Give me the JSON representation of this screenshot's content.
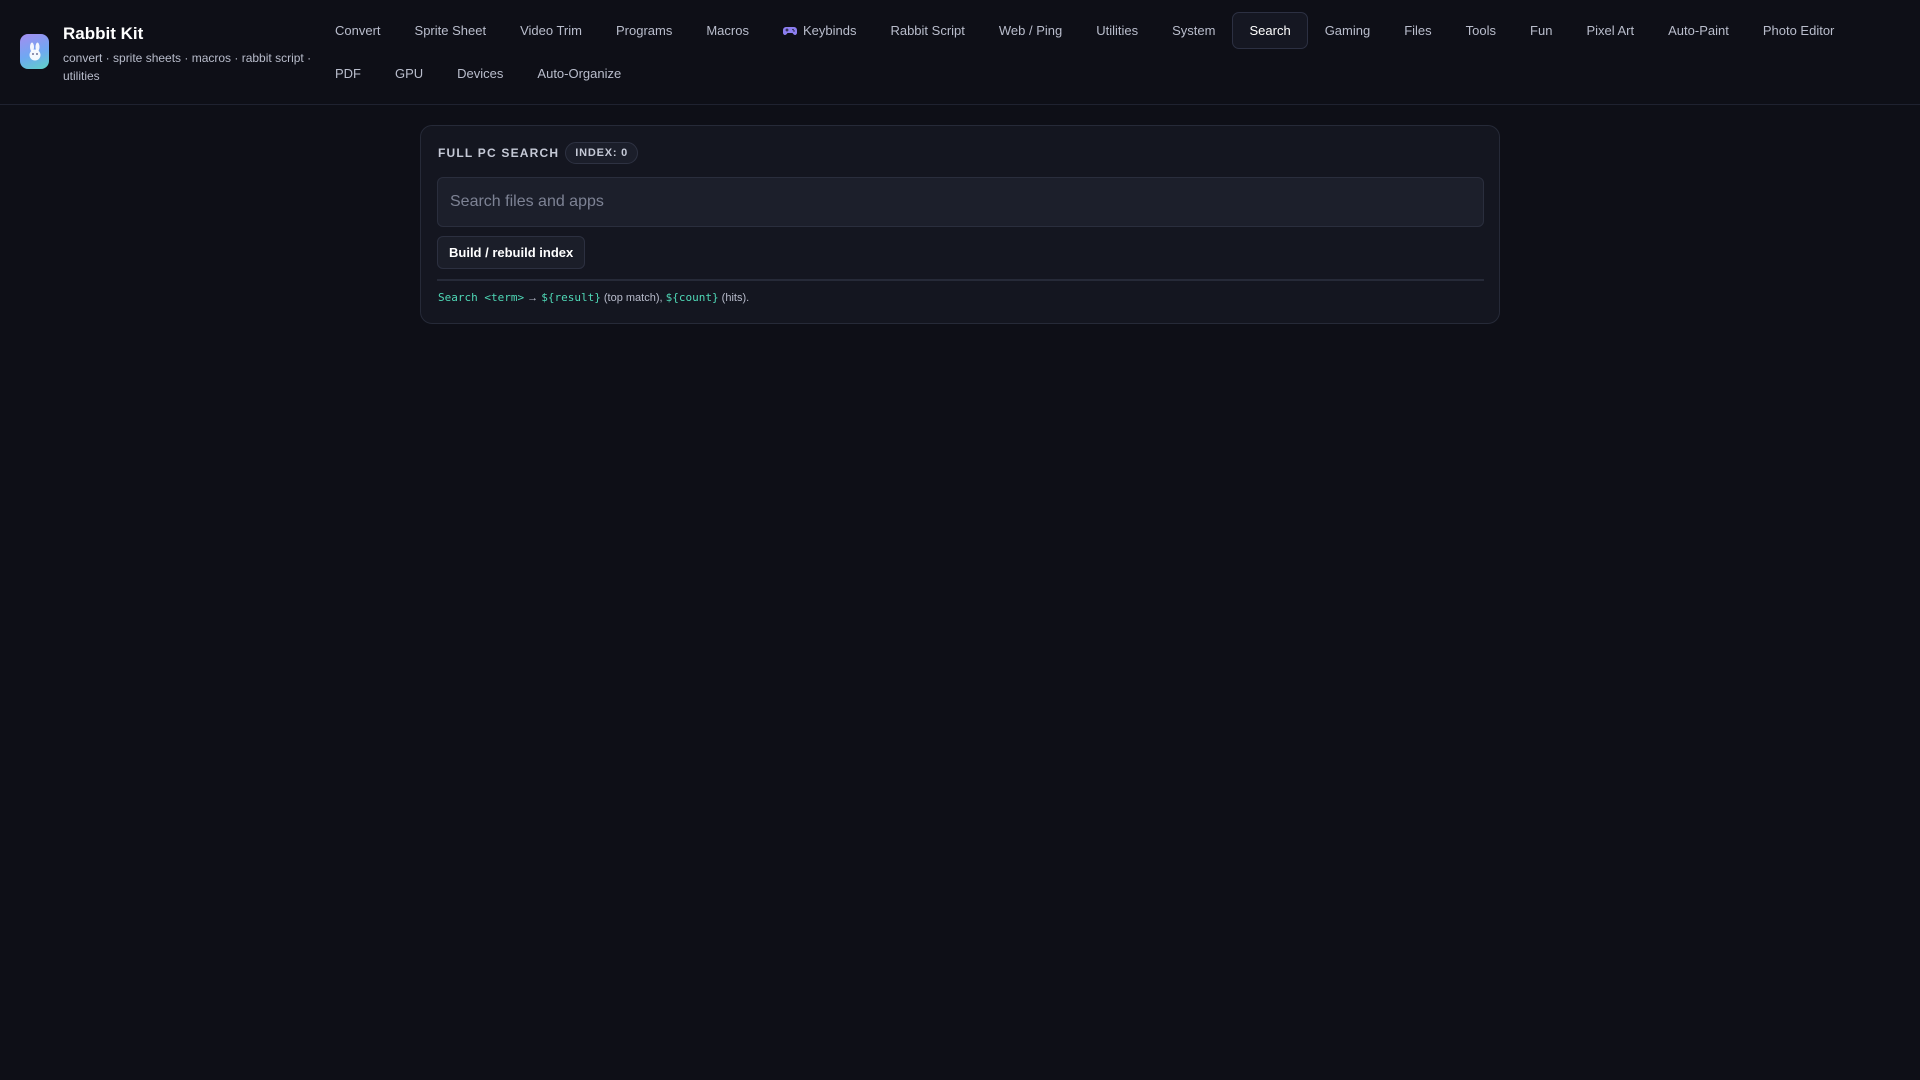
{
  "app": {
    "title": "Rabbit Kit",
    "subtitle": "convert · sprite sheets · macros · rabbit script · utilities",
    "logo_icon": "rabbit-icon"
  },
  "nav": {
    "active": "Search",
    "items": [
      {
        "label": "Convert"
      },
      {
        "label": "Sprite Sheet"
      },
      {
        "label": "Video Trim"
      },
      {
        "label": "Programs"
      },
      {
        "label": "Macros"
      },
      {
        "label": "Keybinds",
        "icon": "gamepad-icon"
      },
      {
        "label": "Rabbit Script"
      },
      {
        "label": "Web / Ping"
      },
      {
        "label": "Utilities"
      },
      {
        "label": "System"
      },
      {
        "label": "Search"
      },
      {
        "label": "Gaming"
      },
      {
        "label": "Files"
      },
      {
        "label": "Tools"
      },
      {
        "label": "Fun"
      },
      {
        "label": "Pixel Art"
      },
      {
        "label": "Auto-Paint"
      },
      {
        "label": "Photo Editor"
      },
      {
        "label": "PDF"
      },
      {
        "label": "GPU"
      },
      {
        "label": "Devices"
      },
      {
        "label": "Auto-Organize"
      }
    ]
  },
  "search_panel": {
    "title": "FULL PC SEARCH",
    "index_badge": "INDEX: 0",
    "input_value": "",
    "input_placeholder": "Search files and apps",
    "build_button": "Build / rebuild index",
    "hint": {
      "cmd": "Search <term>",
      "arrow": " → ",
      "result_var": "${result}",
      "result_desc": " (top match), ",
      "count_var": "${count}",
      "count_desc": " (hits)."
    }
  },
  "colors": {
    "background": "#0e0f17",
    "panel": "#141620",
    "accent_code": "#4fd8b6",
    "logo_gradient_start": "#a58cf0",
    "logo_gradient_end": "#5fd3c6"
  }
}
